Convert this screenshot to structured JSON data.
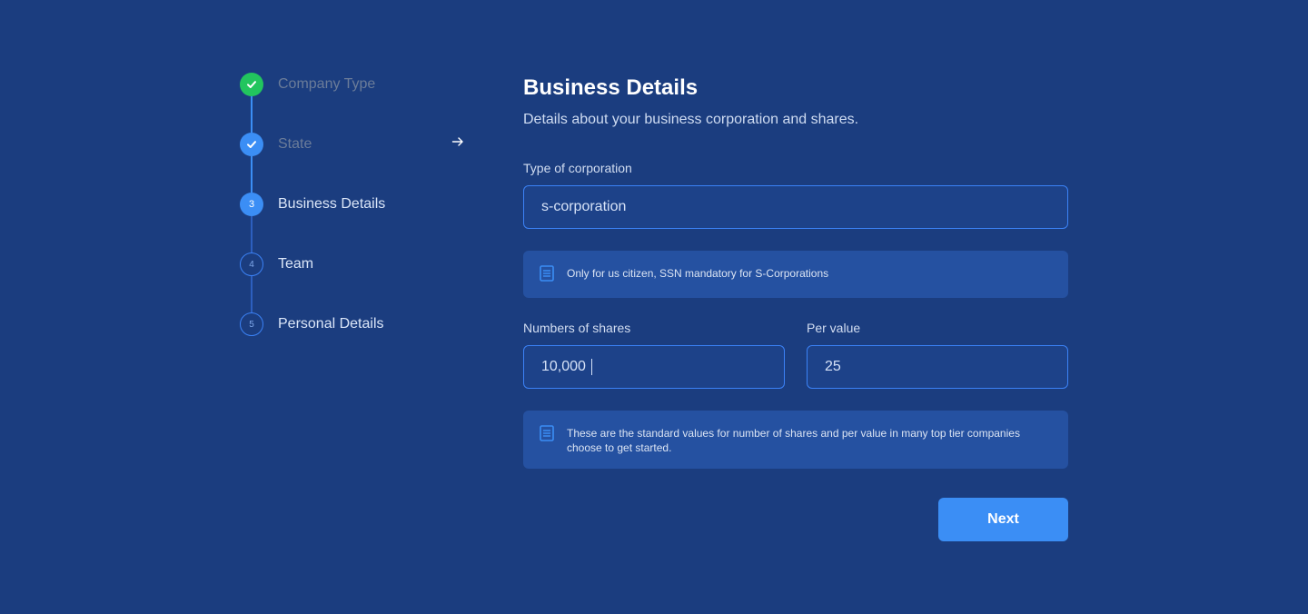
{
  "stepper": {
    "steps": [
      {
        "number": "",
        "label": "Company Type",
        "status": "completed"
      },
      {
        "number": "",
        "label": "State",
        "status": "completed"
      },
      {
        "number": "3",
        "label": "Business Details",
        "status": "current"
      },
      {
        "number": "4",
        "label": "Team",
        "status": "upcoming"
      },
      {
        "number": "5",
        "label": "Personal Details",
        "status": "upcoming"
      }
    ]
  },
  "main": {
    "title": "Business Details",
    "subtitle": "Details about your business corporation and shares.",
    "corporation": {
      "label": "Type of corporation",
      "value": "s-corporation"
    },
    "corporation_note": "Only for us citizen, SSN mandatory for S-Corporations",
    "shares": {
      "label": "Numbers of shares",
      "value": "10,000"
    },
    "per_value": {
      "label": "Per value",
      "value": "25"
    },
    "shares_note": "These are the standard values for number of shares and per value in many top tier companies choose to get started.",
    "next_label": "Next"
  },
  "icons": {
    "completed": "check-icon",
    "note": "document-icon",
    "arrow": "arrow-right-icon"
  },
  "colors": {
    "background": "#1b3d7f",
    "accent": "#3b8ef5",
    "success": "#22c55e",
    "input_border": "#3b82f6",
    "info_background": "#2551a1"
  }
}
